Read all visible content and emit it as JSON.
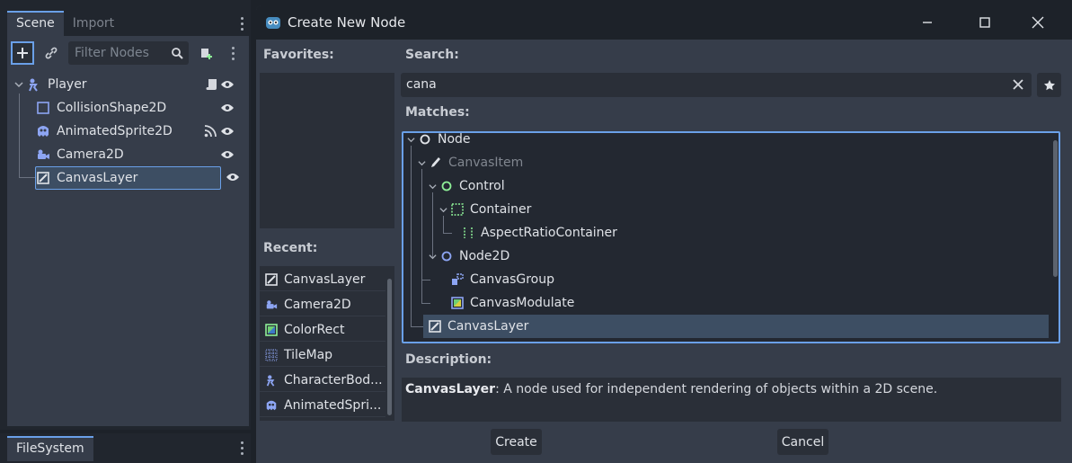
{
  "scene_dock": {
    "tabs": [
      "Scene",
      "Import"
    ],
    "filter_placeholder": "Filter Nodes",
    "tree": [
      {
        "label": "Player",
        "icon": "characterbody2d-icon",
        "indent": 0
      },
      {
        "label": "CollisionShape2D",
        "icon": "collisionshape2d-icon",
        "indent": 1
      },
      {
        "label": "AnimatedSprite2D",
        "icon": "animatedsprite2d-icon",
        "indent": 1
      },
      {
        "label": "Camera2D",
        "icon": "camera2d-icon",
        "indent": 1
      },
      {
        "label": "CanvasLayer",
        "icon": "canvaslayer-icon",
        "indent": 1,
        "selected": true
      }
    ]
  },
  "filesystem_dock": {
    "tab": "FileSystem"
  },
  "dialog": {
    "title": "Create New Node",
    "favorites_label": "Favorites:",
    "recent_label": "Recent:",
    "recent": [
      "CanvasLayer",
      "Camera2D",
      "ColorRect",
      "TileMap",
      "CharacterBod...",
      "AnimatedSpri..."
    ],
    "search_label": "Search:",
    "search_value": "cana",
    "matches_label": "Matches:",
    "matches": [
      "Node",
      "CanvasItem",
      "Control",
      "Container",
      "AspectRatioContainer",
      "Node2D",
      "CanvasGroup",
      "CanvasModulate",
      "CanvasLayer"
    ],
    "description_label": "Description:",
    "description_name": "CanvasLayer",
    "description_text": ": A node used for independent rendering of objects within a 2D scene.",
    "create_label": "Create",
    "cancel_label": "Cancel"
  },
  "colors": {
    "accent": "#6aa0e8",
    "node2d_blue": "#8da5f3",
    "control_green": "#8eef97",
    "selection": "#3d4e63"
  }
}
